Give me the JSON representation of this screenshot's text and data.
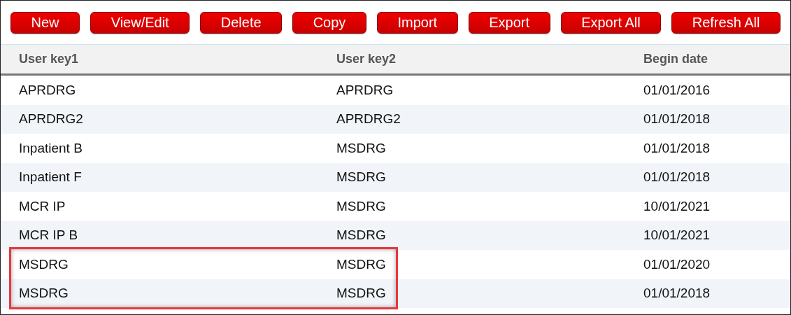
{
  "toolbar": {
    "buttons": [
      "New",
      "View/Edit",
      "Delete",
      "Copy",
      "Import",
      "Export",
      "Export All",
      "Refresh All"
    ]
  },
  "table": {
    "columns": [
      "User key1",
      "User key2",
      "Begin date"
    ],
    "rows": [
      {
        "cells": [
          "APRDRG",
          "APRDRG",
          "01/01/2016"
        ],
        "highlighted": false
      },
      {
        "cells": [
          "APRDRG2",
          "APRDRG2",
          "01/01/2018"
        ],
        "highlighted": false
      },
      {
        "cells": [
          "Inpatient B",
          "MSDRG",
          "01/01/2018"
        ],
        "highlighted": false
      },
      {
        "cells": [
          "Inpatient F",
          "MSDRG",
          "01/01/2018"
        ],
        "highlighted": false
      },
      {
        "cells": [
          "MCR IP",
          "MSDRG",
          "10/01/2021"
        ],
        "highlighted": false
      },
      {
        "cells": [
          "MCR IP B",
          "MSDRG",
          "10/01/2021"
        ],
        "highlighted": false
      },
      {
        "cells": [
          "MSDRG",
          "MSDRG",
          "01/01/2020"
        ],
        "highlighted": true
      },
      {
        "cells": [
          "MSDRG",
          "MSDRG",
          "01/01/2018"
        ],
        "highlighted": true
      }
    ]
  }
}
